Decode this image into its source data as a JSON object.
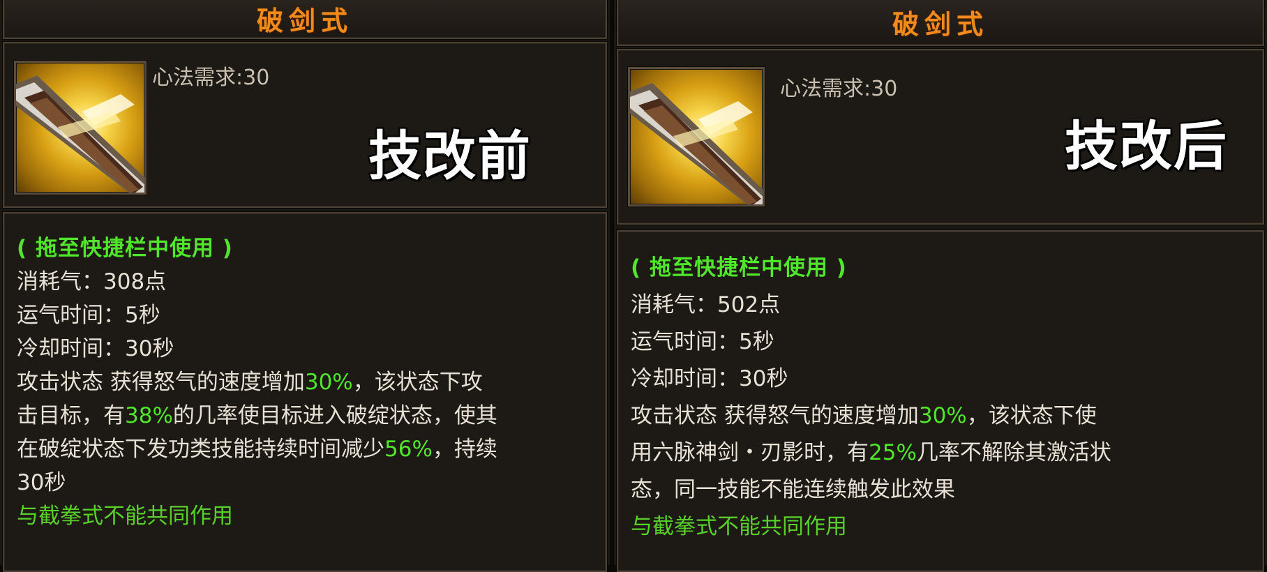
{
  "panels": [
    {
      "title": "破剑式",
      "requirement": "心法需求:30",
      "stage_label": "技改前",
      "usage_hint": "( 拖至快捷栏中使用 )",
      "qi_cost": "消耗气：308点",
      "cast_time": "运气时间：5秒",
      "cooldown": "冷却时间：30秒",
      "effect": {
        "l1a": "攻击状态 获得怒气的速度增加",
        "l1pct": "30%",
        "l1b": "，该状态下攻",
        "l2a": "击目标，有",
        "l2pct": "38%",
        "l2b": "的几率使目标进入破绽状态，使其",
        "l3a": "在破绽状态下发功类技能持续时间减少",
        "l3pct": "56%",
        "l3b": "，持续",
        "l4": "30秒"
      },
      "exclusive_note": "与截拳式不能共同作用",
      "icon": "sword-icon"
    },
    {
      "title": "破剑式",
      "requirement": "心法需求:30",
      "stage_label": "技改后",
      "usage_hint": "( 拖至快捷栏中使用 )",
      "qi_cost": "消耗气：502点",
      "cast_time": "运气时间：5秒",
      "cooldown": "冷却时间：30秒",
      "effect": {
        "l1a": "攻击状态 获得怒气的速度增加",
        "l1pct": "30%",
        "l1b": "，该状态下使",
        "l2a": "用六脉神剑・刃影时，有",
        "l2pct": "25%",
        "l2b": "几率不解除其激活状",
        "l3": "态，同一技能不能连续触发此效果"
      },
      "exclusive_note": "与截拳式不能共同作用",
      "icon": "sword-icon"
    }
  ],
  "colors": {
    "title": "#f08a1c",
    "green_highlight": "#4fe62c",
    "text": "#e7e1d6",
    "panel_bg": "#1a1612"
  }
}
